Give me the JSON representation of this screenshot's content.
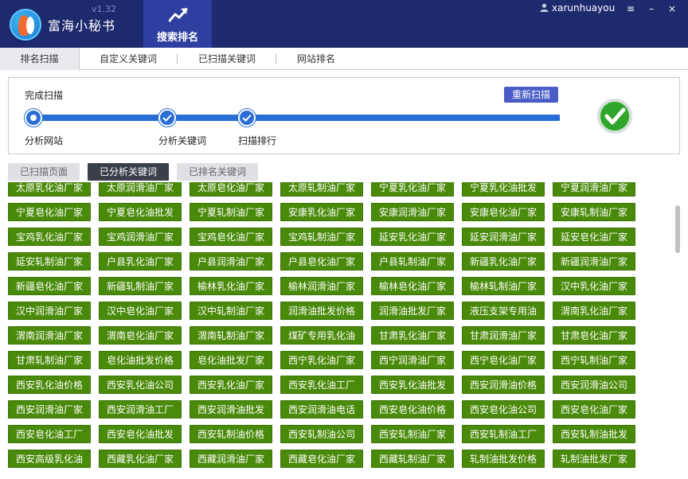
{
  "app": {
    "name": "富海小秘书",
    "version": "v1.32"
  },
  "nav": {
    "active_tab": "搜索排名",
    "icon": "trend-chart-icon"
  },
  "user": {
    "name": "xarunhuayou"
  },
  "window_controls": {
    "menu": "≡",
    "minimize": "–",
    "close": "×"
  },
  "subtabs": [
    "排名扫描",
    "自定义关键词",
    "已扫描关键词",
    "网站排名"
  ],
  "scan": {
    "status": "完成扫描",
    "rescan_label": "重新扫描",
    "steps": [
      "分析网站",
      "分析关键词",
      "扫描排行"
    ],
    "progress": 1.0
  },
  "keyword_tabs": [
    "已扫描页面",
    "已分析关键词",
    "已排名关键词"
  ],
  "keywords": [
    "太原乳化油厂家",
    "太原润滑油厂家",
    "太原皂化油厂家",
    "太原轧制油厂家",
    "宁夏乳化油厂家",
    "宁夏乳化油批发",
    "宁夏润滑油厂家",
    "宁夏皂化油厂家",
    "宁夏皂化油批发",
    "宁夏轧制油厂家",
    "安康乳化油厂家",
    "安康润滑油厂家",
    "安康皂化油厂家",
    "安康轧制油厂家",
    "宝鸡乳化油厂家",
    "宝鸡润滑油厂家",
    "宝鸡皂化油厂家",
    "宝鸡轧制油厂家",
    "延安乳化油厂家",
    "延安润滑油厂家",
    "延安皂化油厂家",
    "延安轧制油厂家",
    "户县乳化油厂家",
    "户县润滑油厂家",
    "户县皂化油厂家",
    "户县轧制油厂家",
    "新疆乳化油厂家",
    "新疆润滑油厂家",
    "新疆皂化油厂家",
    "新疆轧制油厂家",
    "榆林乳化油厂家",
    "榆林润滑油厂家",
    "榆林皂化油厂家",
    "榆林轧制油厂家",
    "汉中乳化油厂家",
    "汉中润滑油厂家",
    "汉中皂化油厂家",
    "汉中轧制油厂家",
    "润滑油批发价格",
    "润滑油批发厂家",
    "液压支架专用油",
    "渭南乳化油厂家",
    "渭南润滑油厂家",
    "渭南皂化油厂家",
    "渭南轧制油厂家",
    "煤矿专用乳化油",
    "甘肃乳化油厂家",
    "甘肃润滑油厂家",
    "甘肃皂化油厂家",
    "甘肃轧制油厂家",
    "皂化油批发价格",
    "皂化油批发厂家",
    "西宁乳化油厂家",
    "西宁润滑油厂家",
    "西宁皂化油厂家",
    "西宁轧制油厂家",
    "西安乳化油价格",
    "西安乳化油公司",
    "西安乳化油厂家",
    "西安乳化油工厂",
    "西安乳化油批发",
    "西安润滑油价格",
    "西安润滑油公司",
    "西安润滑油厂家",
    "西安润滑油工厂",
    "西安润滑油批发",
    "西安润滑油电话",
    "西安皂化油价格",
    "西安皂化油公司",
    "西安皂化油厂家",
    "西安皂化油工厂",
    "西安皂化油批发",
    "西安轧制油价格",
    "西安轧制油公司",
    "西安轧制油厂家",
    "西安轧制油工厂",
    "西安轧制油批发",
    "西安高级乳化油",
    "西藏乳化油厂家",
    "西藏润滑油厂家",
    "西藏皂化油厂家",
    "西藏轧制油厂家",
    "轧制油批发价格",
    "轧制油批发厂家"
  ],
  "colors": {
    "titlebar": "#1d2a6e",
    "nav_active": "#2f3fa0",
    "accent_blue": "#2b6dd6",
    "keyword_green": "#4a8a0a",
    "done_green": "#2fa52b"
  }
}
